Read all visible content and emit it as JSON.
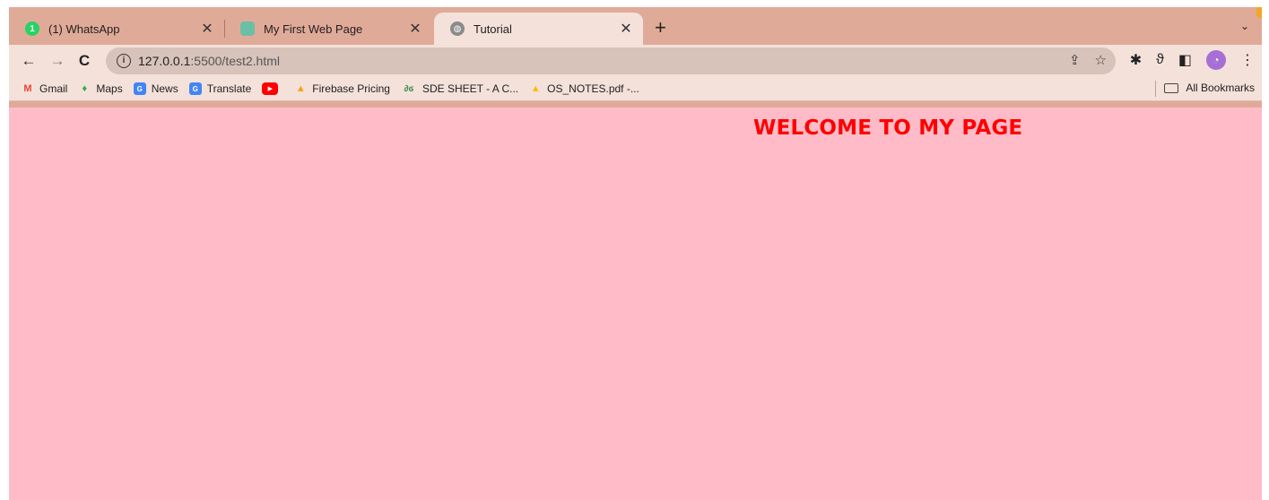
{
  "tabs": [
    {
      "label": "(1) WhatsApp",
      "icon": "whatsapp-icon",
      "badge": "1"
    },
    {
      "label": "My First Web Page",
      "icon": "site-icon"
    },
    {
      "label": "Tutorial",
      "icon": "globe-icon",
      "active": true
    }
  ],
  "toolbar": {
    "url_host": "127.0.0.1",
    "url_rest": ":5500/test2.html"
  },
  "bookmarks": [
    {
      "label": "Gmail",
      "icon": "gmail-icon",
      "color": "#ea4335"
    },
    {
      "label": "Maps",
      "icon": "maps-icon",
      "color": "#34a853"
    },
    {
      "label": "News",
      "icon": "news-icon",
      "color": "#4285f4"
    },
    {
      "label": "Translate",
      "icon": "translate-icon",
      "color": "#4285f4"
    },
    {
      "label": "",
      "icon": "youtube-icon",
      "color": "#ff0000"
    },
    {
      "label": "Firebase Pricing",
      "icon": "firebase-icon",
      "color": "#ffa000"
    },
    {
      "label": "SDE SHEET - A C...",
      "icon": "gfg-icon",
      "color": "#2f8d46"
    },
    {
      "label": "OS_NOTES.pdf -...",
      "icon": "drive-icon",
      "color": "#fbbc04"
    }
  ],
  "all_bookmarks_label": "All Bookmarks",
  "page": {
    "heading": "WELCOME TO MY PAGE",
    "background": "#ffbbc8",
    "heading_color": "#ff0000"
  },
  "chrome_color": "#e0aa98"
}
